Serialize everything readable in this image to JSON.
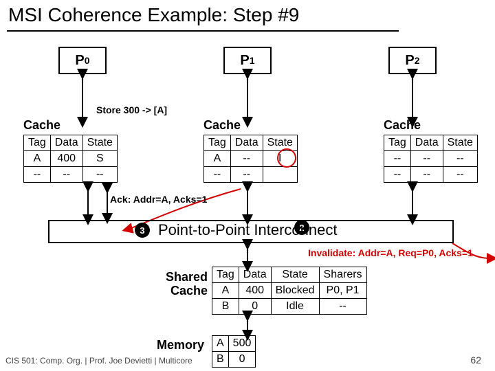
{
  "title": "MSI Coherence Example: Step #9",
  "processors": {
    "p0": "P",
    "p0s": "0",
    "p1": "P",
    "p1s": "1",
    "p2": "P",
    "p2s": "2"
  },
  "annot": {
    "store": "Store 300 -> [A]",
    "ack": "Ack: Addr=A, Acks=1",
    "inval": "Invalidate: Addr=A, Req=P0, Acks=1",
    "step3": "3",
    "step2": "2"
  },
  "cache_label": "Cache",
  "headers": {
    "tag": "Tag",
    "data": "Data",
    "state": "State",
    "sharers": "Sharers"
  },
  "p0c": {
    "r1t": "A",
    "r1d": "400",
    "r1s": "S",
    "r2t": "--",
    "r2d": "--",
    "r2s": "--"
  },
  "p1c": {
    "r1t": "A",
    "r1d": "--",
    "r1s": "I",
    "r2t": "--",
    "r2d": "--"
  },
  "p2c": {
    "r1t": "--",
    "r1d": "--",
    "r1s": "--",
    "r2t": "--",
    "r2d": "--",
    "r2s": "--"
  },
  "interconnect": "Point-to-Point Interconnect",
  "shared_label_1": "Shared",
  "shared_label_2": "Cache",
  "shared": {
    "r1t": "A",
    "r1d": "400",
    "r1st": "Blocked",
    "r1sh": "P0, P1",
    "r2t": "B",
    "r2d": "0",
    "r2st": "Idle",
    "r2sh": "--"
  },
  "memory_label": "Memory",
  "mem": {
    "r1t": "A",
    "r1d": "500",
    "r2t": "B",
    "r2d": "0"
  },
  "footer": "CIS 501: Comp. Org. | Prof. Joe Devietti | Multicore",
  "pagenum": "62"
}
